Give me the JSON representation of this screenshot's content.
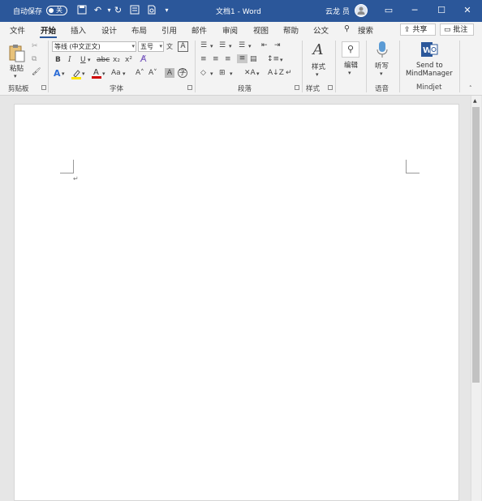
{
  "titlebar": {
    "autosave_label": "自动保存",
    "autosave_state": "关",
    "doc_title": "文档1 - Word",
    "user_name": "云龙 员",
    "icons": [
      "save-icon",
      "undo-icon",
      "redo-icon",
      "form-icon",
      "print-preview-icon",
      "customize-qat-icon"
    ]
  },
  "tabs": [
    {
      "label": "文件"
    },
    {
      "label": "开始",
      "active": true
    },
    {
      "label": "插入"
    },
    {
      "label": "设计"
    },
    {
      "label": "布局"
    },
    {
      "label": "引用"
    },
    {
      "label": "邮件"
    },
    {
      "label": "审阅"
    },
    {
      "label": "视图"
    },
    {
      "label": "帮助"
    },
    {
      "label": "公文"
    }
  ],
  "search": {
    "label": "搜索"
  },
  "header_buttons": {
    "share": "共享",
    "comment": "批注"
  },
  "ribbon": {
    "clipboard": {
      "paste_label": "粘贴",
      "group_label": "剪贴板"
    },
    "font": {
      "font_name": "等线 (中文正文)",
      "font_size": "五号",
      "bold": "B",
      "italic": "I",
      "underline": "U",
      "strike": "abc",
      "subscript": "x₂",
      "superscript": "x²",
      "change_case": "Aa",
      "grow": "A˄",
      "shrink": "A˅",
      "group_label": "字体"
    },
    "paragraph": {
      "group_label": "段落"
    },
    "styles": {
      "label": "样式",
      "group_label": "样式"
    },
    "editing": {
      "label": "编辑"
    },
    "voice": {
      "label": "听写",
      "group_label": "语音"
    },
    "mindjet": {
      "line1": "Send to",
      "line2": "MindManager",
      "group_label": "Mindjet"
    }
  },
  "colors": {
    "titlebar": "#2b579a",
    "ribbon": "#f3f3f3",
    "accent": "#2b579a",
    "highlight": "#ffe600",
    "font_color": "#d00000"
  }
}
